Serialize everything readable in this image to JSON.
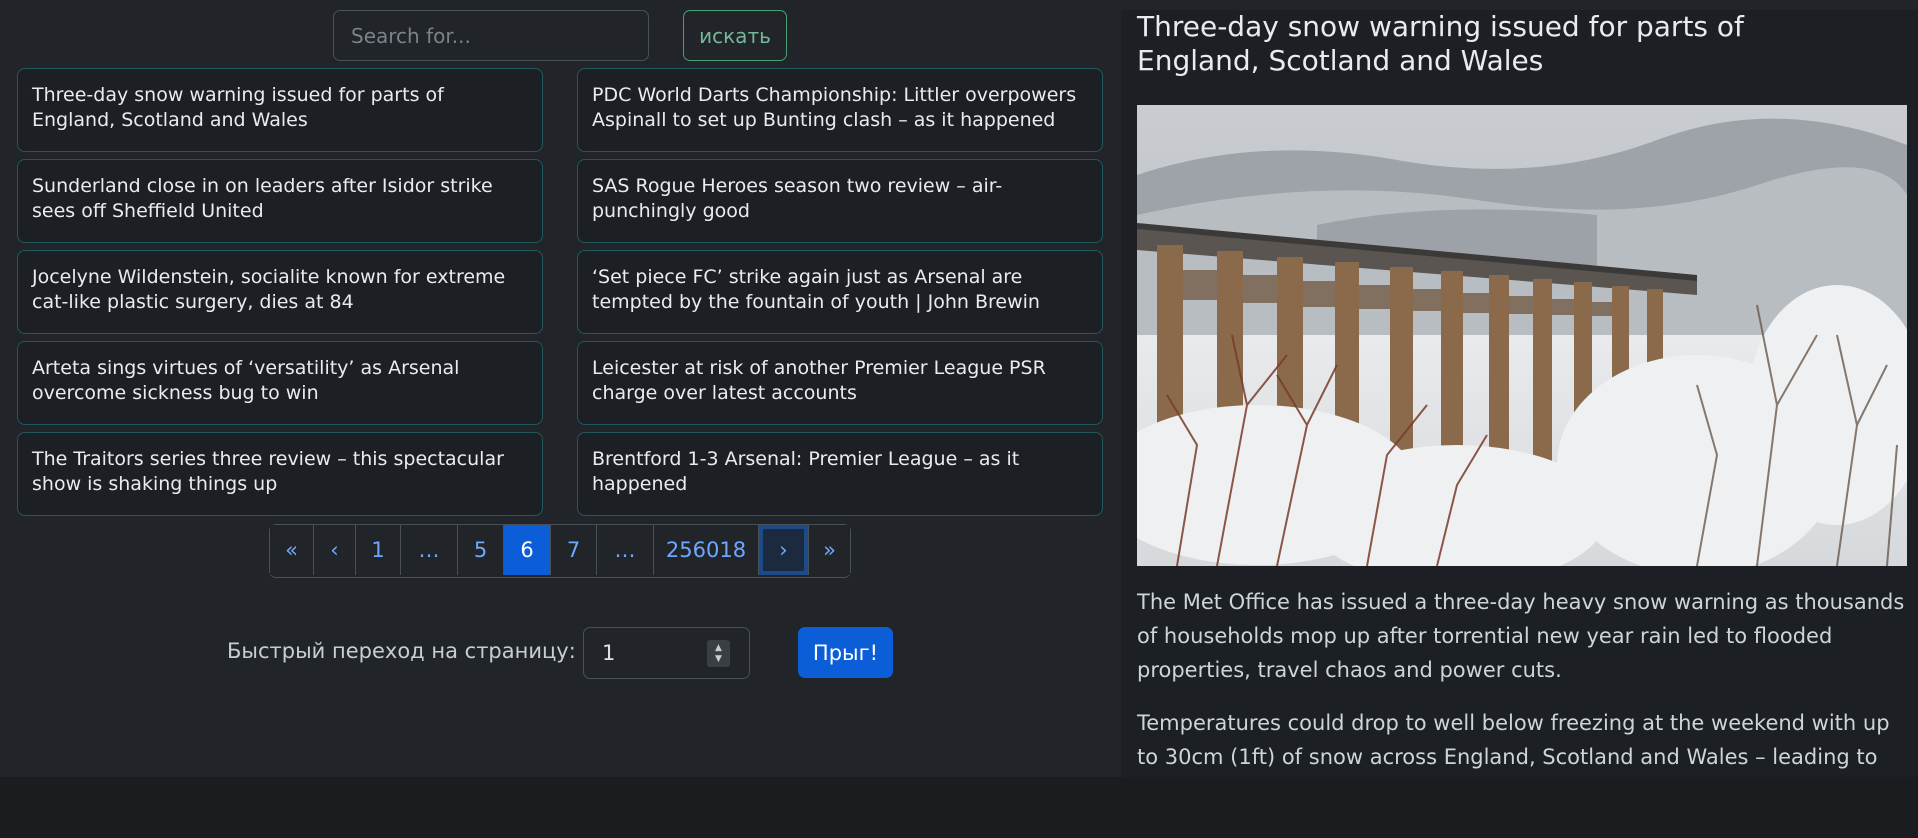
{
  "search": {
    "placeholder": "Search for...",
    "button_label": "искать"
  },
  "news": [
    "Three-day snow warning issued for parts of England, Scotland and Wales",
    "PDC World Darts Championship: Littler overpowers Aspinall to set up Bunting clash – as it happened",
    "Sunderland close in on leaders after Isidor strike sees off Sheffield United",
    "SAS Rogue Heroes season two review – air-punchingly good",
    "Jocelyne Wildenstein, socialite known for extreme cat-like plastic surgery, dies at 84",
    "‘Set piece FC’ strike again just as Arsenal are tempted by the fountain of youth | John Brewin",
    "Arteta sings virtues of ‘versatility’ as Arsenal overcome sickness bug to win",
    "Leicester at risk of another Premier League PSR charge over latest accounts",
    "The Traitors series three review – this spectacular show is shaking things up",
    "Brentford 1-3 Arsenal: Premier League – as it happened"
  ],
  "pagination": {
    "first": "«",
    "prev": "‹",
    "p1": "1",
    "ellipsis_left": "…",
    "p5": "5",
    "p6": "6",
    "p7": "7",
    "ellipsis_right": "…",
    "last_page": "256018",
    "next": "›",
    "last": "»",
    "current": 6
  },
  "jump": {
    "label": "Быстрый переход на страницу:",
    "value": "1",
    "button_label": "Прыг!"
  },
  "article": {
    "title": "Three-day snow warning issued for parts of England, Scotland and Wales",
    "paragraph1": "The Met Office has issued a three-day heavy snow warning as thousands of households mop up after torrential new year rain led to flooded properties, travel chaos and power cuts.",
    "paragraph2": "Temperatures could drop to well below freezing at the weekend with up to 30cm (1ft) of snow across England, Scotland and Wales – leading to rural"
  },
  "colors": {
    "accent": "#0b5ed7",
    "success": "#75b798",
    "link": "#6ea8fe"
  }
}
